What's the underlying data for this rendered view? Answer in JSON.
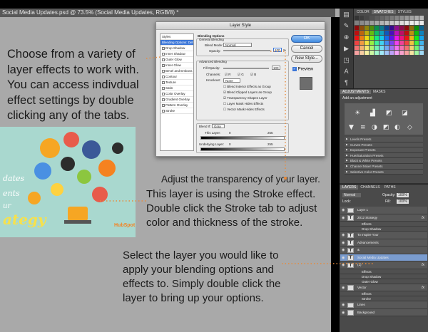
{
  "window": {
    "doc_tab": "Social Media Updates.psd @ 73.5% (Social Media Updates, RGB/8) *"
  },
  "annotations": {
    "left": "Choose from a variety of\n layer effects to work with.\nYou can access indivdual\neffect settings by double\nclicking any of the tabs.",
    "transparency": "Adjust the transparency of your layer.",
    "stroke": "This layer is using the Stroke effect.\nDouble click the Stroke tab to adjust\ncolor and thickness of the stroke.",
    "select": "Select the  layer you would like to\napply your blending options and\neffects to. Simply double click the\nlayer to bring up your options."
  },
  "promo": {
    "lines": [
      "dates",
      "ents",
      "ur",
      "ategy"
    ],
    "brand": "HubSpot"
  },
  "dialog": {
    "title": "Layer Style",
    "styles": [
      {
        "label": "Styles",
        "sel": false,
        "cb": false
      },
      {
        "label": "Blending Options: Default",
        "sel": true,
        "cb": false
      },
      {
        "label": "Drop Shadow",
        "sel": false,
        "cb": true
      },
      {
        "label": "Inner Shadow",
        "sel": false,
        "cb": true
      },
      {
        "label": "Outer Glow",
        "sel": false,
        "cb": true
      },
      {
        "label": "Inner Glow",
        "sel": false,
        "cb": true
      },
      {
        "label": "Bevel and Emboss",
        "sel": false,
        "cb": true
      },
      {
        "label": "Contour",
        "sel": false,
        "cb": true
      },
      {
        "label": "Texture",
        "sel": false,
        "cb": true
      },
      {
        "label": "Satin",
        "sel": false,
        "cb": true
      },
      {
        "label": "Color Overlay",
        "sel": false,
        "cb": true
      },
      {
        "label": "Gradient Overlay",
        "sel": false,
        "cb": true
      },
      {
        "label": "Pattern Overlay",
        "sel": false,
        "cb": true
      },
      {
        "label": "Stroke",
        "sel": false,
        "cb": true
      }
    ],
    "blending_options": "Blending Options",
    "general_blending": "General Blending",
    "blend_mode_label": "Blend Mode:",
    "blend_mode_value": "Normal",
    "opacity_label": "Opacity:",
    "opacity_value": "100",
    "percent": "%",
    "advanced_blending": "Advanced Blending",
    "fill_opacity_label": "Fill Opacity:",
    "fill_opacity_value": "100",
    "channels_label": "Channels:",
    "channels": [
      "R",
      "G",
      "B"
    ],
    "knockout_label": "Knockout:",
    "knockout_value": "None",
    "checks": [
      "Blend Interior Effects as Group",
      "Blend Clipped Layers as Group",
      "Transparency Shapes Layer",
      "Layer Mask Hides Effects",
      "Vector Mask Hides Effects"
    ],
    "blend_if_label": "Blend If:",
    "blend_if_value": "Gray",
    "this_layer": "This Layer:",
    "underlying_layer": "Underlying Layer:",
    "range_min": "0",
    "range_max": "255",
    "ok": "OK",
    "cancel": "Cancel",
    "new_style": "New Style...",
    "preview": "Preview"
  },
  "panels": {
    "swatch_tabs": [
      "COLOR",
      "SWATCHES",
      "STYLES"
    ],
    "adjust_tabs": [
      "ADJUSTMENTS",
      "MASKS"
    ],
    "add_adjustment": "Add an adjustment",
    "presets": [
      "Levels Presets",
      "Curves Presets",
      "Exposure Presets",
      "Hue/Saturation Presets",
      "Black & White Presets",
      "Channel Mixer Presets",
      "Selective Color Presets"
    ],
    "layer_tabs": [
      "LAYERS",
      "CHANNELS",
      "PATHS"
    ],
    "blend_mode": "Normal",
    "opacity_label": "Opacity:",
    "opacity_value": "100%",
    "lock_label": "Lock:",
    "fill_label": "Fill:",
    "fill_value": "100%",
    "layers": [
      {
        "name": "Layer 1",
        "type": "img",
        "sel": false,
        "sub": false,
        "fx": false
      },
      {
        "name": "2012 Strategy",
        "type": "T",
        "sel": false,
        "sub": false,
        "fx": true
      },
      {
        "name": "Effects",
        "type": "",
        "sel": false,
        "sub": true,
        "fx": false
      },
      {
        "name": "Drop Shadow",
        "type": "",
        "sel": false,
        "sub": true,
        "fx": false
      },
      {
        "name": "To Inspire Your",
        "type": "T",
        "sel": false,
        "sub": false,
        "fx": false
      },
      {
        "name": "Advancements",
        "type": "T",
        "sel": false,
        "sub": false,
        "fx": false
      },
      {
        "name": "&",
        "type": "T",
        "sel": false,
        "sub": false,
        "fx": false
      },
      {
        "name": "Social Media Updates",
        "type": "T",
        "sel": true,
        "sub": false,
        "fx": false
      },
      {
        "name": "(1)",
        "type": "T",
        "sel": false,
        "sub": false,
        "fx": true
      },
      {
        "name": "Effects",
        "type": "",
        "sel": false,
        "sub": true,
        "fx": false
      },
      {
        "name": "Drop Shadow",
        "type": "",
        "sel": false,
        "sub": true,
        "fx": false
      },
      {
        "name": "Outer Glow",
        "type": "",
        "sel": false,
        "sub": true,
        "fx": false
      },
      {
        "name": "Vector",
        "type": "img",
        "sel": false,
        "sub": false,
        "fx": true
      },
      {
        "name": "Effects",
        "type": "",
        "sel": false,
        "sub": true,
        "fx": false
      },
      {
        "name": "Stroke",
        "type": "",
        "sel": false,
        "sub": true,
        "fx": false
      },
      {
        "name": "Lines",
        "type": "img",
        "sel": false,
        "sub": false,
        "fx": false
      },
      {
        "name": "Background",
        "type": "img",
        "sel": false,
        "sub": false,
        "fx": false
      }
    ],
    "fx_label": "fx"
  },
  "colors": {
    "accent_line": "#e88a3a",
    "selection": "#7a9ccf",
    "ok_button": "#3f8ae0"
  }
}
